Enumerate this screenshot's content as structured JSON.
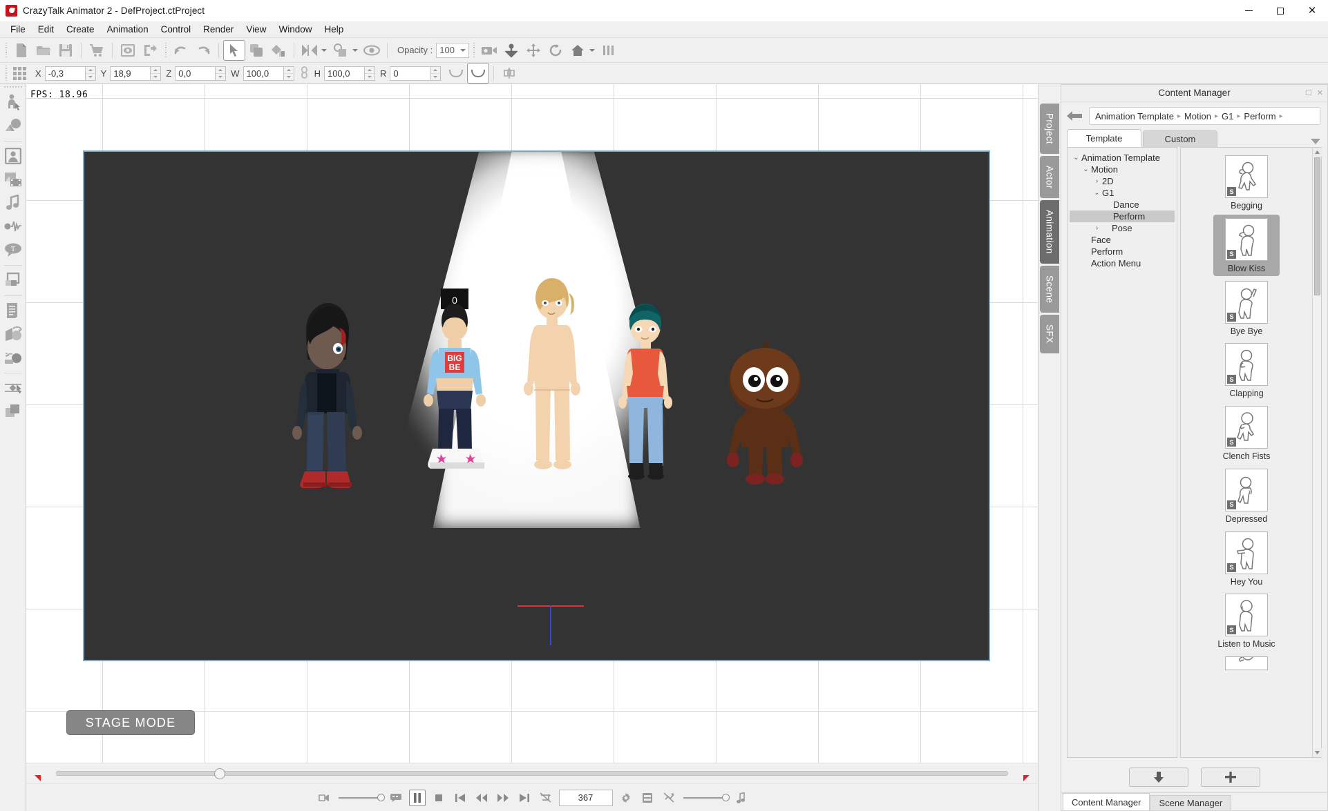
{
  "window": {
    "title": "CrazyTalk Animator 2   - DefProject.ctProject",
    "logo_icon": "crazytalk-logo-icon",
    "minimize_icon": "minimize-icon",
    "maximize_icon": "maximize-icon",
    "close_icon": "close-icon",
    "close_glyph": "✕"
  },
  "menubar": {
    "items": [
      {
        "label": "File"
      },
      {
        "label": "Edit"
      },
      {
        "label": "Create"
      },
      {
        "label": "Animation"
      },
      {
        "label": "Control"
      },
      {
        "label": "Render"
      },
      {
        "label": "View"
      },
      {
        "label": "Window"
      },
      {
        "label": "Help"
      }
    ]
  },
  "toolbar": {
    "buttons": [
      {
        "name": "new-project-icon",
        "tip": "New"
      },
      {
        "name": "open-project-icon",
        "tip": "Open"
      },
      {
        "name": "save-project-icon",
        "tip": "Save"
      },
      {
        "name": "marketplace-cart-icon",
        "tip": "Content Store"
      },
      {
        "name": "preview-icon",
        "tip": "Preview"
      },
      {
        "name": "export-icon",
        "tip": "Export"
      },
      {
        "name": "undo-icon",
        "tip": "Undo"
      },
      {
        "name": "redo-icon",
        "tip": "Redo"
      },
      {
        "name": "select-tool-icon",
        "tip": "Select",
        "active": true
      },
      {
        "name": "copy-layer-icon",
        "tip": "Duplicate"
      },
      {
        "name": "fill-color-icon",
        "tip": "Color Fill"
      },
      {
        "name": "flip-horizontal-icon",
        "tip": "Flip"
      },
      {
        "name": "link-object-icon",
        "tip": "Link"
      },
      {
        "name": "visibility-eye-icon",
        "tip": "Show / Hide"
      }
    ],
    "opacity_label": "Opacity :",
    "opacity_value": "100",
    "right_buttons": [
      {
        "name": "camera-icon",
        "tip": "Camera"
      },
      {
        "name": "anchor-icon",
        "tip": "Anchor"
      },
      {
        "name": "move-tool-icon",
        "tip": "Move"
      },
      {
        "name": "rotate-tool-icon",
        "tip": "Rotate"
      },
      {
        "name": "home-view-icon",
        "tip": "Home"
      },
      {
        "name": "align-columns-icon",
        "tip": "Align"
      }
    ]
  },
  "propertybar": {
    "grid_icon": "transform-grid-icon",
    "fields": [
      {
        "label": "X",
        "value": "-0,3"
      },
      {
        "label": "Y",
        "value": "18,9"
      },
      {
        "label": "Z",
        "value": "0,0"
      },
      {
        "label": "W",
        "value": "100,0"
      },
      {
        "label": "H",
        "value": "100,0"
      },
      {
        "label": "R",
        "value": "0"
      }
    ],
    "link_icon": "chain-link-icon",
    "curve_icon": "curve-icon",
    "curve_active_icon": "curve-active-icon",
    "flip_icon": "flip-axis-icon"
  },
  "leftrail": {
    "items": [
      {
        "name": "actor-tool-icon",
        "label": "Actor"
      },
      {
        "name": "prop-tool-icon",
        "label": "Prop"
      },
      {
        "name": "face-tool-icon",
        "label": "Face"
      },
      {
        "name": "media-tool-icon",
        "label": "Media"
      },
      {
        "name": "audio-tool-icon",
        "label": "Audio"
      },
      {
        "name": "waveform-tool-icon",
        "label": "Waveform"
      },
      {
        "name": "text-bubble-tool-icon",
        "label": "Speech Bubble"
      },
      {
        "name": "layers-tool-icon",
        "label": "Layers"
      },
      {
        "name": "script-tool-icon",
        "label": "Script"
      },
      {
        "name": "transform-tool-icon",
        "label": "Transform"
      },
      {
        "name": "motion-record-tool-icon",
        "label": "Motion Record"
      },
      {
        "name": "keyframe-tool-icon",
        "label": "Keyframe"
      },
      {
        "name": "composer-tool-icon",
        "label": "Composer"
      }
    ]
  },
  "stage": {
    "fps_text": "FPS: 18.96",
    "mode_label": "STAGE MODE",
    "background_color": "#333333",
    "border_color": "#7ba7c9",
    "characters": [
      {
        "name": "emo-boy-character"
      },
      {
        "name": "pop-girl-character"
      },
      {
        "name": "nude-figure-character"
      },
      {
        "name": "teal-hair-girl-character"
      },
      {
        "name": "acorn-creature-character"
      }
    ]
  },
  "timeline": {
    "scrub_position_percent": 16.6,
    "start_marker_icon": "range-start-marker-icon",
    "end_marker_icon": "range-end-marker-icon"
  },
  "transport": {
    "frame_value": "367",
    "left_slider_icon": "playback-speed-icon",
    "controls": [
      {
        "name": "speed-slider",
        "type": "slider"
      },
      {
        "name": "subtitle-toggle-icon",
        "glyph": "⌨"
      },
      {
        "name": "play-pause-button",
        "glyph": "‖",
        "active": true
      },
      {
        "name": "stop-button",
        "glyph": "■"
      },
      {
        "name": "go-to-start-button",
        "glyph": "⏮"
      },
      {
        "name": "step-back-button",
        "glyph": "◀◀"
      },
      {
        "name": "step-forward-button",
        "glyph": "▶▶"
      },
      {
        "name": "go-to-end-button",
        "glyph": "⏭"
      },
      {
        "name": "loop-off-button",
        "glyph": "⊘"
      }
    ],
    "right_controls": [
      {
        "name": "settings-gear-icon",
        "glyph": "⚙"
      },
      {
        "name": "timeline-panel-icon"
      },
      {
        "name": "mute-audio-icon"
      },
      {
        "name": "volume-slider",
        "type": "slider"
      },
      {
        "name": "music-note-icon",
        "glyph": "♪"
      }
    ]
  },
  "sidetabs": {
    "items": [
      {
        "label": "Project",
        "active": false
      },
      {
        "label": "Actor",
        "active": false
      },
      {
        "label": "Animation",
        "active": true
      },
      {
        "label": "Scene",
        "active": false
      },
      {
        "label": "SFX",
        "active": false
      }
    ]
  },
  "content_manager": {
    "title": "Content Manager",
    "undock_icon": "undock-icon",
    "close_icon": "panel-close-icon",
    "back_icon": "back-arrow-icon",
    "breadcrumb": [
      "Animation Template",
      "Motion",
      "G1",
      "Perform"
    ],
    "breadcrumb_separator": "▸",
    "tabs": [
      {
        "label": "Template",
        "active": true
      },
      {
        "label": "Custom",
        "active": false
      }
    ],
    "dropdown_icon": "chevron-down-icon",
    "tree": [
      {
        "label": "Animation Template",
        "indent": 0,
        "twisty": "⌄",
        "expanded": true,
        "selected": false
      },
      {
        "label": "Motion",
        "indent": 1,
        "twisty": "⌄",
        "expanded": true,
        "selected": false
      },
      {
        "label": "2D",
        "indent": 2,
        "twisty": "›",
        "expanded": false,
        "selected": false
      },
      {
        "label": "G1",
        "indent": 2,
        "twisty": "⌄",
        "expanded": true,
        "selected": false
      },
      {
        "label": "Dance",
        "indent": 3,
        "twisty": "",
        "expanded": false,
        "selected": false
      },
      {
        "label": "Perform",
        "indent": 3,
        "twisty": "",
        "expanded": false,
        "selected": true
      },
      {
        "label": "Pose",
        "indent": 3,
        "twisty": "›",
        "expanded": false,
        "selected": false
      },
      {
        "label": "Face",
        "indent": 1,
        "twisty": "",
        "expanded": false,
        "selected": false
      },
      {
        "label": "Perform",
        "indent": 1,
        "twisty": "",
        "expanded": false,
        "selected": false
      },
      {
        "label": "Action Menu",
        "indent": 1,
        "twisty": "",
        "expanded": false,
        "selected": false
      }
    ],
    "items": [
      {
        "label": "Begging",
        "badge": "S",
        "selected": false
      },
      {
        "label": "Blow Kiss",
        "badge": "S",
        "selected": true
      },
      {
        "label": "Bye Bye",
        "badge": "S",
        "selected": false
      },
      {
        "label": "Clapping",
        "badge": "S",
        "selected": false
      },
      {
        "label": "Clench Fists",
        "badge": "S",
        "selected": false
      },
      {
        "label": "Depressed",
        "badge": "S",
        "selected": false
      },
      {
        "label": "Hey You",
        "badge": "S",
        "selected": false
      },
      {
        "label": "Listen to Music",
        "badge": "S",
        "selected": false
      },
      {
        "label": "",
        "badge": "S",
        "selected": false
      }
    ],
    "footer": [
      {
        "name": "apply-down-button",
        "glyph": "⬇"
      },
      {
        "name": "add-custom-button",
        "glyph": "＋"
      }
    ]
  },
  "bottom_tabs": [
    {
      "label": "Content Manager",
      "active": true
    },
    {
      "label": "Scene Manager",
      "active": false
    }
  ],
  "colors": {
    "accent_blue": "#7ba7c9",
    "stage_dark": "#333333",
    "chrome": "#f0f0f0",
    "selection_gray": "#a8a8a8",
    "marker_red": "#d22a2a",
    "logo_red": "#c3161c"
  }
}
